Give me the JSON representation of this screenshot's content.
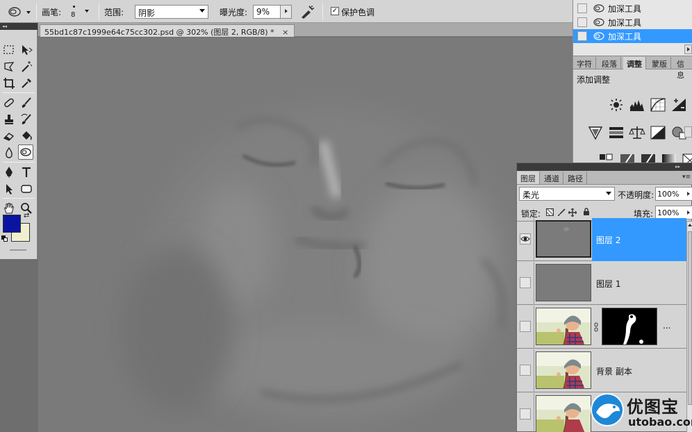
{
  "options_bar": {
    "brush_label": "画笔:",
    "brush_size": "8",
    "range_label": "范围:",
    "range_value": "阴影",
    "exposure_label": "曝光度:",
    "exposure_value": "9%",
    "protect_label": "保护色调",
    "protect_checked": "✓"
  },
  "document": {
    "tab_title": "55bd1c87c1999e64c75cc302.psd @ 302% (图层 2, RGB/8) *",
    "close": "×"
  },
  "tools": {
    "foreground_color": "#0a14a0",
    "background_color": "#f0f0d0"
  },
  "history": {
    "items": [
      {
        "label": "加深工具",
        "selected": false
      },
      {
        "label": "加深工具",
        "selected": false
      },
      {
        "label": "加深工具",
        "selected": true
      }
    ]
  },
  "adjustments_panel": {
    "tabs": [
      "字符",
      "段落",
      "调整",
      "蒙版",
      "信息"
    ],
    "active_tab": "调整",
    "heading": "添加调整"
  },
  "layers_panel": {
    "tabs": [
      "图层",
      "通道",
      "路径"
    ],
    "blend_mode": "柔光",
    "opacity_label": "不透明度:",
    "opacity_value": "100%",
    "lock_label": "锁定:",
    "fill_label": "填充:",
    "fill_value": "100%",
    "layers": [
      {
        "name": "图层 2",
        "selected": true,
        "visible": true
      },
      {
        "name": "图层 1",
        "selected": false,
        "visible": false
      },
      {
        "name": "...",
        "selected": false,
        "visible": false
      },
      {
        "name": "背景 副本",
        "selected": false,
        "visible": false
      },
      {
        "name": "",
        "selected": false,
        "visible": false
      }
    ]
  },
  "watermark": {
    "cn": "优图宝",
    "en": "utobao.com"
  },
  "colors": {
    "selection_blue": "#3399ff",
    "panel_gray": "#d4d4d4"
  }
}
